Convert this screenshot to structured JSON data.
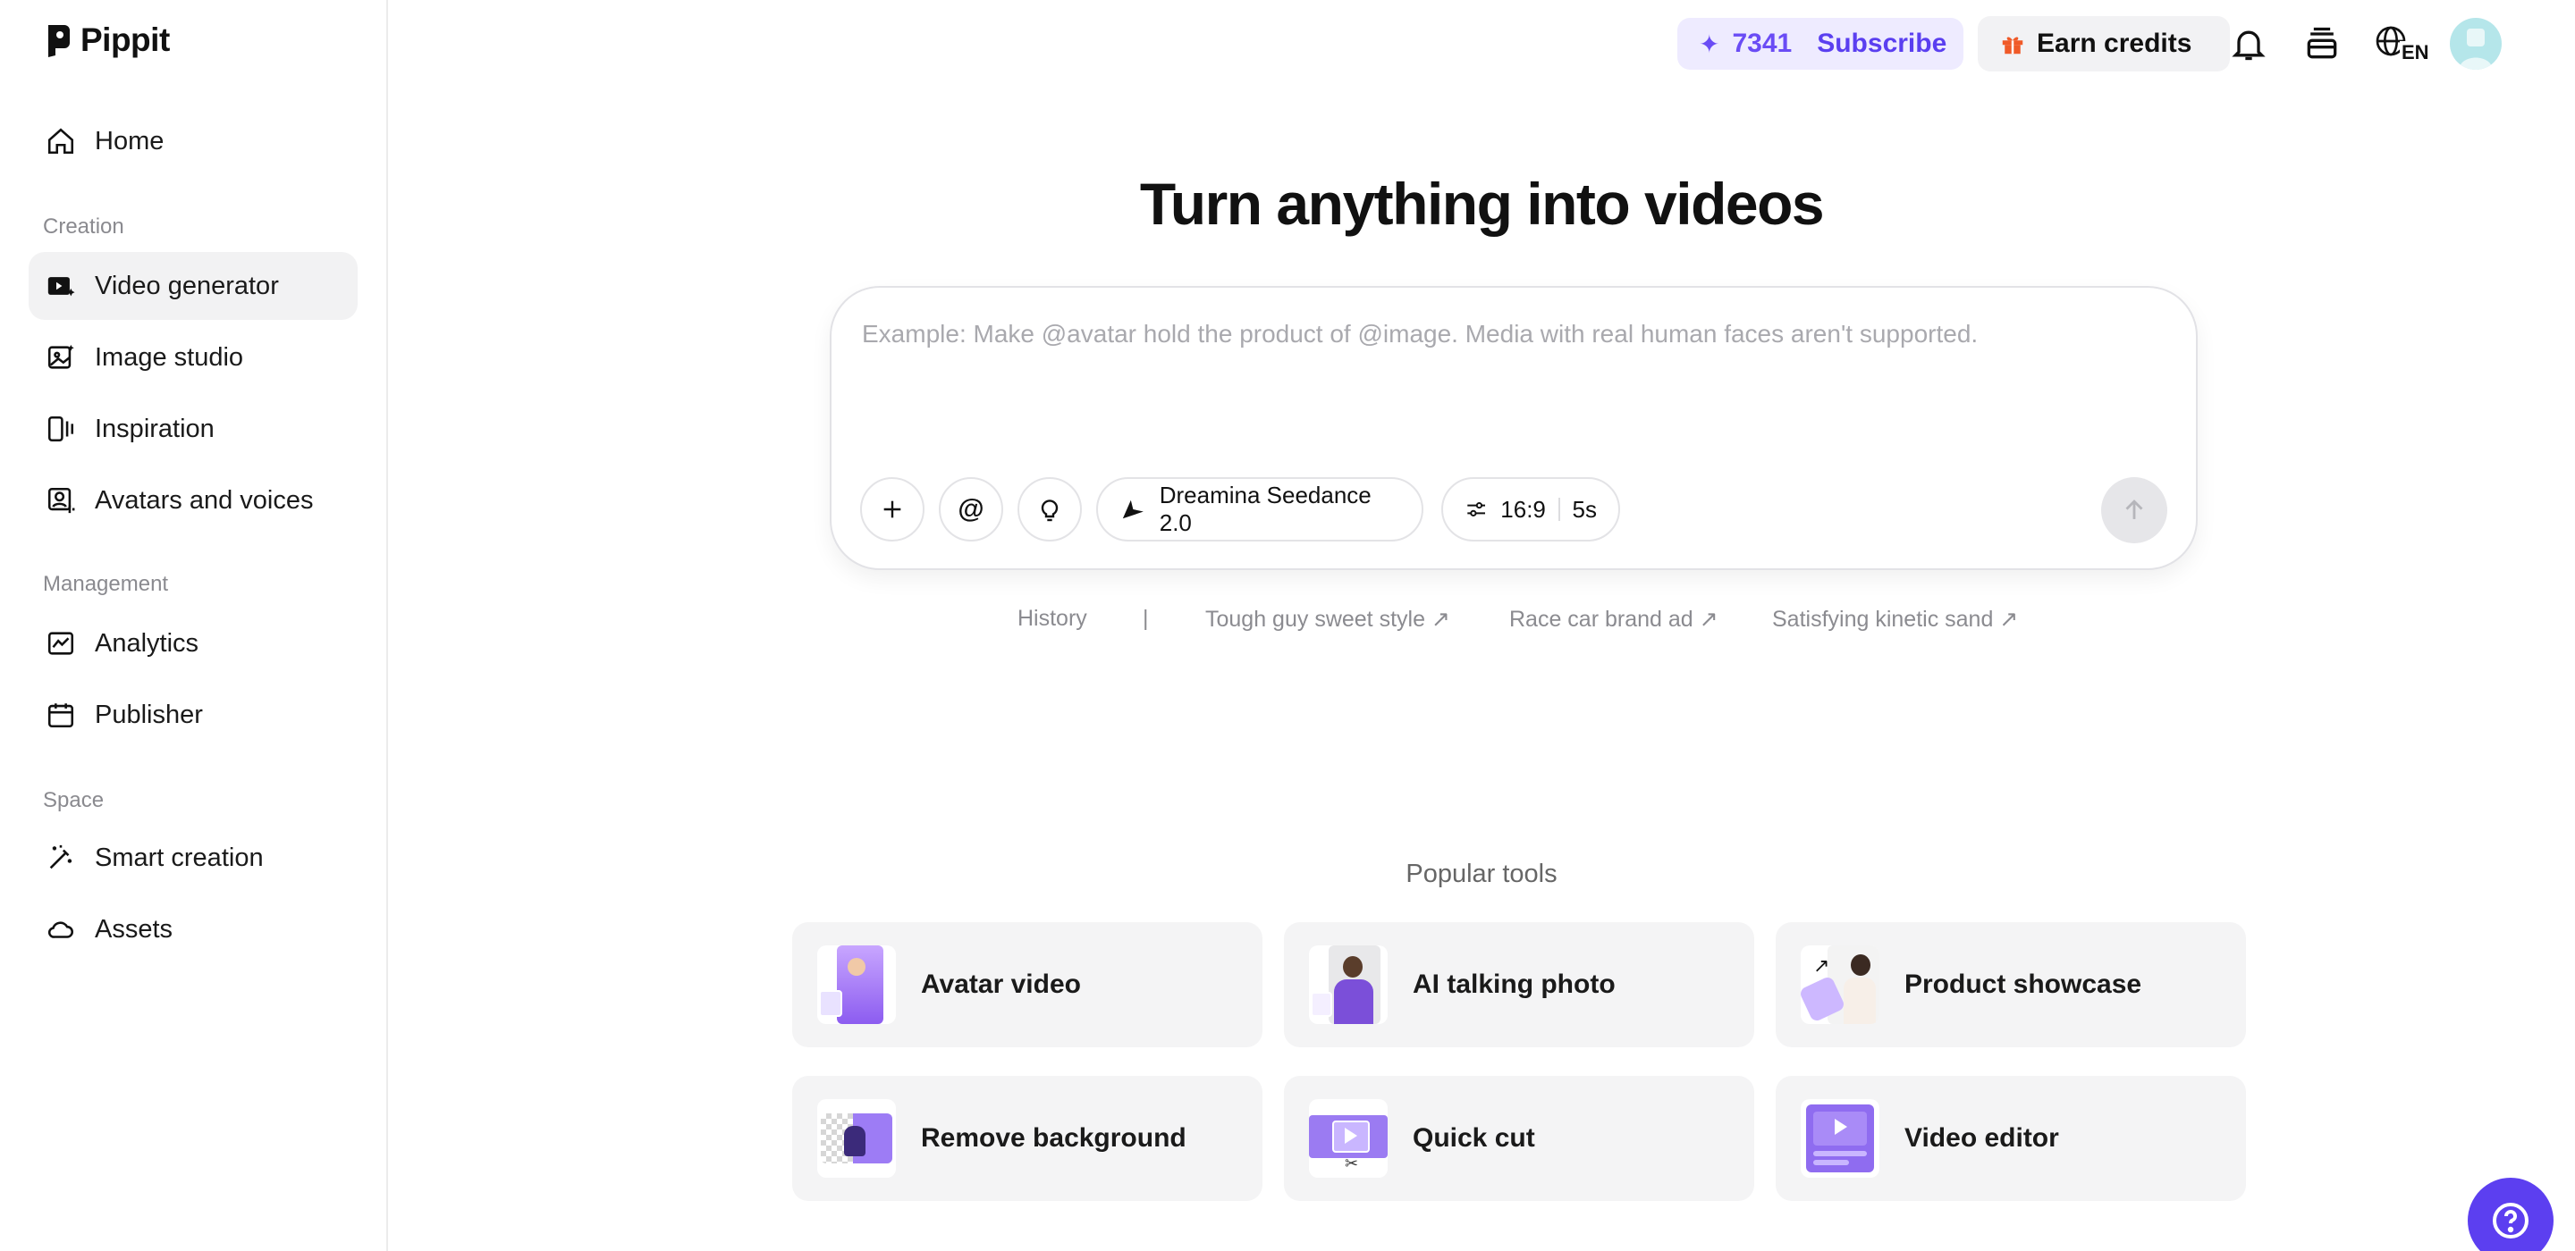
{
  "brand": {
    "name": "Pippit"
  },
  "sidebar": {
    "home": {
      "label": "Home",
      "icon": "home-icon"
    },
    "sections": [
      {
        "title": "Creation"
      },
      {
        "title": "Management"
      },
      {
        "title": "Space"
      }
    ],
    "items": [
      {
        "label": "Video generator",
        "icon": "video-generator-icon",
        "active": true
      },
      {
        "label": "Image studio",
        "icon": "image-studio-icon"
      },
      {
        "label": "Inspiration",
        "icon": "inspiration-icon"
      },
      {
        "label": "Avatars and voices",
        "icon": "avatar-voice-icon"
      },
      {
        "label": "Analytics",
        "icon": "analytics-icon"
      },
      {
        "label": "Publisher",
        "icon": "calendar-icon"
      },
      {
        "label": "Smart creation",
        "icon": "magic-wand-icon"
      },
      {
        "label": "Assets",
        "icon": "cloud-icon"
      }
    ]
  },
  "topbar": {
    "credits": "7341",
    "subscribe_label": "Subscribe",
    "earn_label": "Earn credits",
    "language": "EN"
  },
  "main": {
    "headline": "Turn anything into videos",
    "prompt": {
      "placeholder": "Example: Make @avatar hold the product of @image. Media with real human faces aren't supported.",
      "value": "",
      "model": "Dreamina Seedance 2.0",
      "ratio": "16:9",
      "duration": "5s"
    },
    "suggestions": {
      "history_label": "History",
      "separator": "|",
      "items": [
        "Tough guy sweet style ↗",
        "Race car brand ad ↗",
        "Satisfying kinetic sand ↗"
      ]
    },
    "popular": {
      "title": "Popular tools",
      "tools": [
        {
          "label": "Avatar video"
        },
        {
          "label": "AI talking photo"
        },
        {
          "label": "Product showcase"
        },
        {
          "label": "Remove background"
        },
        {
          "label": "Quick cut"
        },
        {
          "label": "Video editor"
        }
      ]
    }
  },
  "colors": {
    "accent": "#5c3ff0",
    "credits_bg": "#eeebff",
    "active_nav": "#f2f2f3"
  }
}
